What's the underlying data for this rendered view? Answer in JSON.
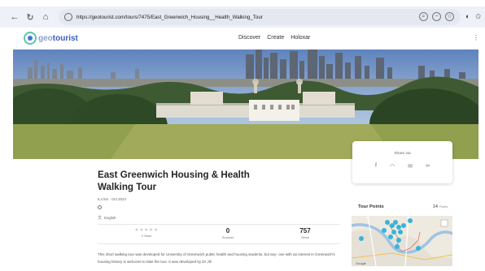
{
  "browser": {
    "url": "https://geotourist.com/tours/7475/East_Greenwich_Housing__Health_Walking_Tour"
  },
  "site": {
    "logo_part1": "geo",
    "logo_part2": "tourist",
    "nav": [
      "Discover",
      "Create",
      "Holoxar"
    ]
  },
  "tour": {
    "title": "East Greenwich Housing & Health Walking Tour",
    "meta": "6.4 km · Oct 2024",
    "language": "English",
    "stats": {
      "stars_label": "0 Stars",
      "success_value": "0",
      "success_label": "Success",
      "views_value": "757",
      "views_label": "Views"
    },
    "description": "This short walking tour was developed for University of Greenwich public health and housing students, but any- one with an interest in Greenwich's housing history is welcome to take the tour. It was developed by Dr Jill"
  },
  "share": {
    "title": "Share via",
    "icons": [
      "facebook-icon",
      "twitter-icon",
      "email-icon",
      "link-icon"
    ]
  },
  "tour_points": {
    "title": "Tour Points",
    "count": "14",
    "unit": "Points"
  },
  "colors": {
    "brand": "#3a5cc4",
    "accent": "#56c7b0",
    "map_marker": "#38b3d9"
  }
}
